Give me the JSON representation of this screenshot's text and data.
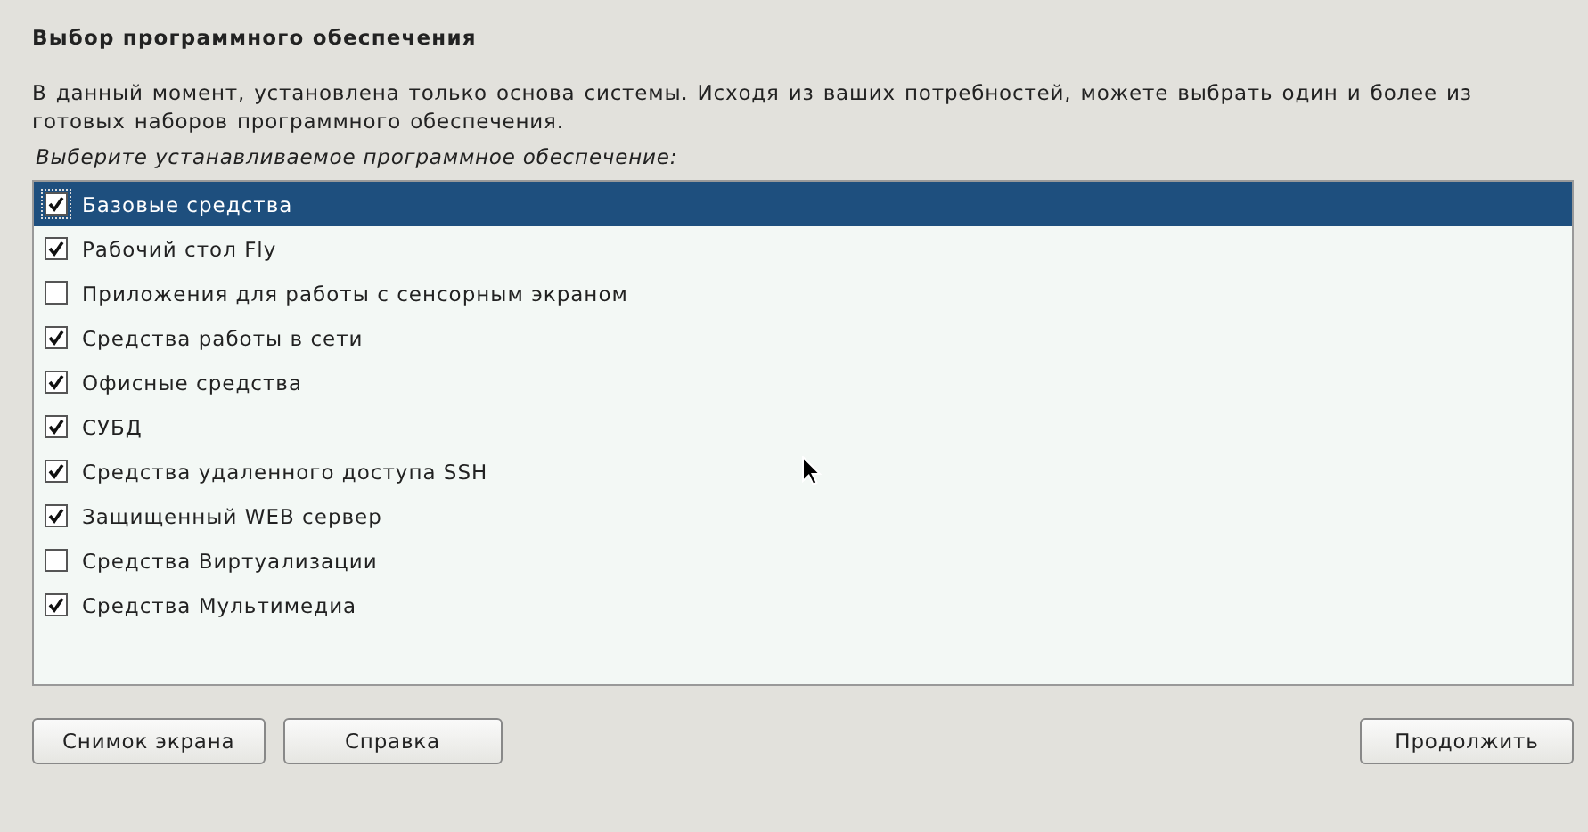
{
  "title": "Выбор программного обеспечения",
  "description": "В данный момент, установлена только основа системы. Исходя из ваших потребностей, можете выбрать один и более из готовых наборов программного обеспечения.",
  "prompt": "Выберите устанавливаемое программное обеспечение:",
  "items": [
    {
      "label": "Базовые средства",
      "checked": true,
      "selected": true
    },
    {
      "label": "Рабочий стол Fly",
      "checked": true,
      "selected": false
    },
    {
      "label": "Приложения для работы с сенсорным экраном",
      "checked": false,
      "selected": false
    },
    {
      "label": "Средства работы в сети",
      "checked": true,
      "selected": false
    },
    {
      "label": "Офисные средства",
      "checked": true,
      "selected": false
    },
    {
      "label": "СУБД",
      "checked": true,
      "selected": false
    },
    {
      "label": "Средства удаленного доступа SSH",
      "checked": true,
      "selected": false
    },
    {
      "label": "Защищенный WEB сервер",
      "checked": true,
      "selected": false
    },
    {
      "label": "Средства Виртуализации",
      "checked": false,
      "selected": false
    },
    {
      "label": "Средства Мультимедиа",
      "checked": true,
      "selected": false
    }
  ],
  "buttons_left": [
    "Снимок экрана",
    "Справка"
  ],
  "buttons_right": [
    "Продолжить"
  ]
}
